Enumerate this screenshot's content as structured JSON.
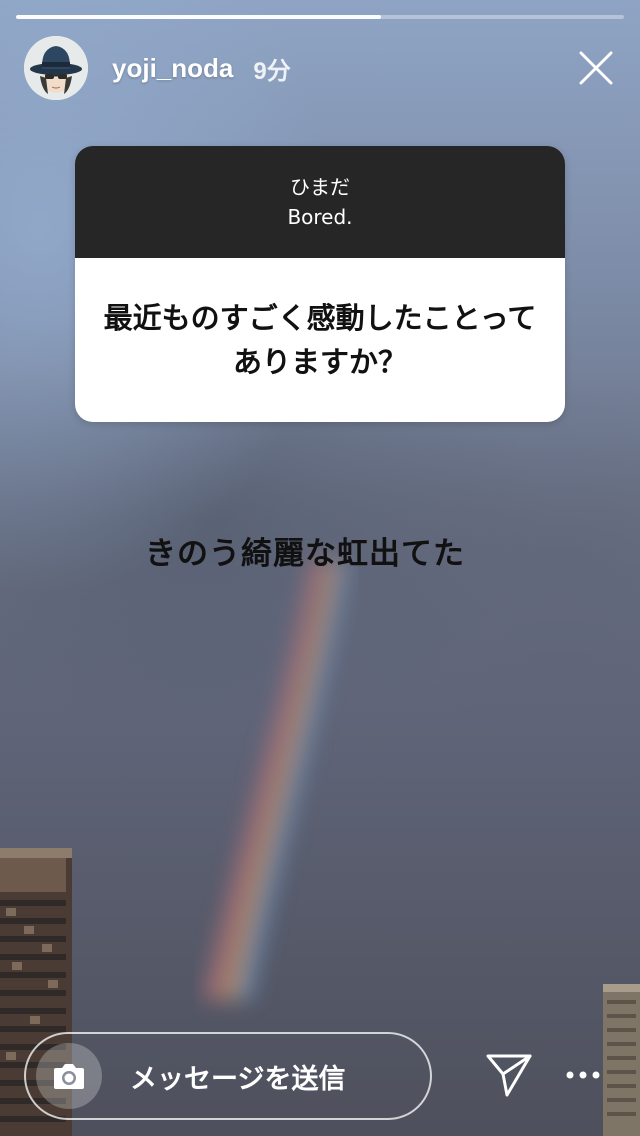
{
  "progress": {
    "fraction": 0.6
  },
  "header": {
    "username": "yoji_noda",
    "time": "9分",
    "avatar_icon": "user-avatar-hat-icon",
    "close_icon": "close-icon"
  },
  "question_card": {
    "responder_label_ja": "ひまだ",
    "responder_label_en": "Bored.",
    "question": "最近ものすごく感動したことってありますか？",
    "top_color": "#262626",
    "bottom_color": "#ffffff"
  },
  "answer": {
    "text": "きのう綺麗な虹出てた"
  },
  "bottom_bar": {
    "message_placeholder": "メッセージを送信",
    "camera_icon": "camera-icon",
    "send_icon": "paper-plane-icon",
    "more_icon": "more-dots-icon"
  }
}
